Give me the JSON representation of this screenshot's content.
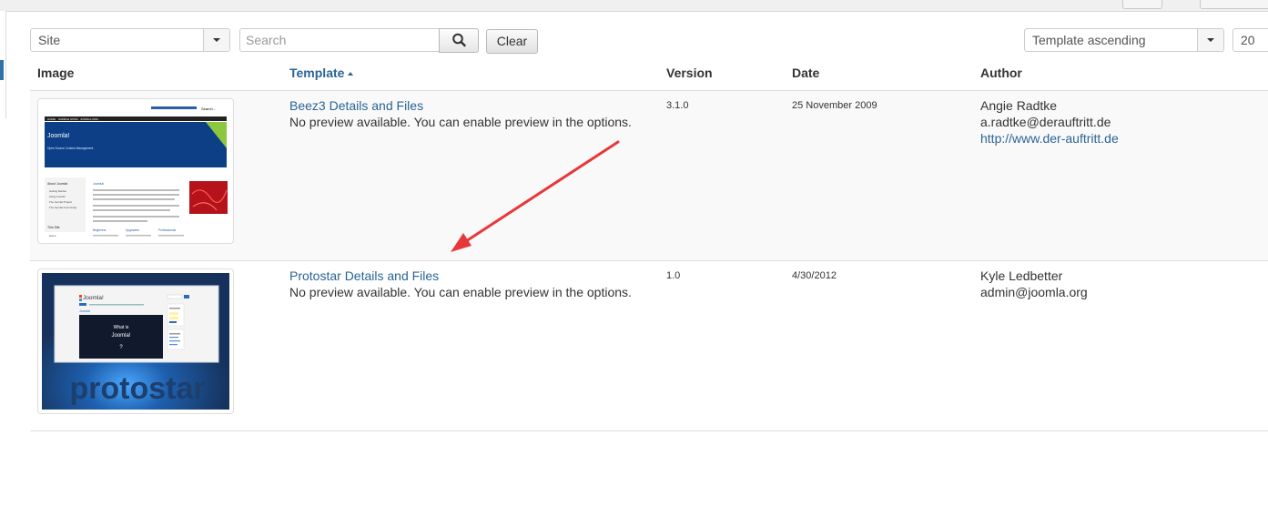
{
  "filters": {
    "client_select": "Site",
    "search_placeholder": "Search",
    "clear_label": "Clear",
    "ordering_select": "Template ascending",
    "limit_select": "20"
  },
  "table": {
    "headers": {
      "image": "Image",
      "template": "Template",
      "version": "Version",
      "date": "Date",
      "author": "Author"
    },
    "rows": [
      {
        "template_link": "Beez3 Details and Files",
        "preview_note": "No preview available. You can enable preview in the options.",
        "version": "3.1.0",
        "date": "25 November 2009",
        "author_name": "Angie Radtke",
        "author_email": "a.radtke@derauftritt.de",
        "author_url": "http://www.der-auftritt.de",
        "thumb": {
          "brand": "Joomla!",
          "tagline": "Open Source Content Management",
          "nav": [
            "HOME",
            "SAMPLE SITES",
            "JOOMLA.ORG"
          ],
          "sidebar_heading": "About Joomla!",
          "sidebar_items": [
            "Getting Started",
            "Using Joomla!",
            "The Joomla! Project",
            "The Joomla! Community"
          ],
          "sidebar_heading_2": "This Site",
          "sidebar_items_2": [
            "Home"
          ],
          "article_title": "Joomla!",
          "columns": [
            "Beginners",
            "Upgraders",
            "Professionals"
          ],
          "search_label": "Search..."
        }
      },
      {
        "template_link": "Protostar Details and Files",
        "preview_note": "No preview available. You can enable preview in the options.",
        "version": "1.0",
        "date": "4/30/2012",
        "author_name": "Kyle Ledbetter",
        "author_email": "admin@joomla.org",
        "thumb": {
          "brand": "Joomla!",
          "article_title": "Joomla!",
          "video_text": [
            "What is",
            "Joomla!",
            "?"
          ],
          "wordmark": "protostar"
        }
      }
    ]
  },
  "colors": {
    "link": "#2a6496",
    "annotation_arrow": "#e8373a",
    "protostar_bg": "#16325c"
  },
  "icons": [
    "search-icon",
    "chevron-down-icon",
    "sort-ascending-icon"
  ]
}
